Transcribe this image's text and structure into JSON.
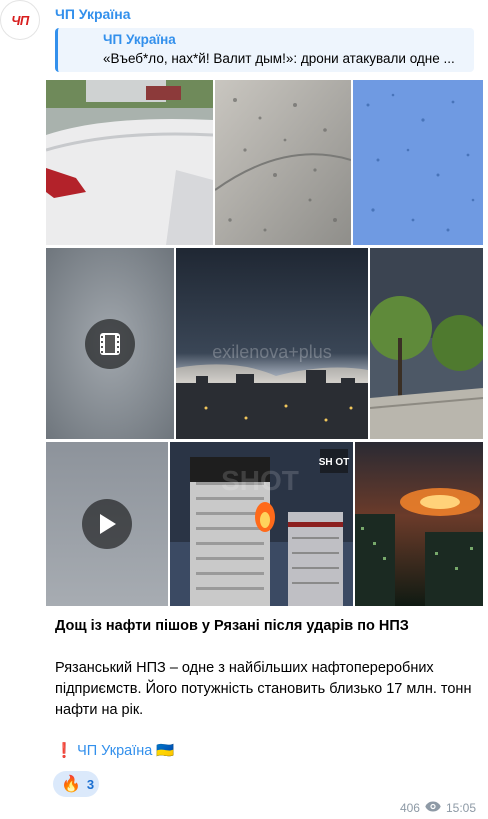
{
  "avatar": {
    "text": "ЧП"
  },
  "channel": {
    "name": "ЧП Україна"
  },
  "reply": {
    "title": "ЧП Україна",
    "text": "«Въеб*ло, нах*й! Валит дым!»: дрони атакували одне ..."
  },
  "media": {
    "watermark": "exilenova+plus",
    "shot_logo": "SH OT",
    "shot_watermark": "SHOT"
  },
  "caption": {
    "title": "Дощ із нафти пішов у Рязані після ударів по НПЗ",
    "body": "Рязанський НПЗ – одне з найбільших нафтопереробних підприємств. Його потужність становить близько 17 млн. тонн нафти на рік."
  },
  "signature": {
    "mark": "❗",
    "name": "ЧП Україна",
    "flag": "🇺🇦"
  },
  "reaction": {
    "emoji": "🔥",
    "count": "3"
  },
  "meta": {
    "views": "406",
    "time": "15:05"
  },
  "colors": {
    "accent": "#3390ec",
    "brand_red": "#d81e1e"
  }
}
